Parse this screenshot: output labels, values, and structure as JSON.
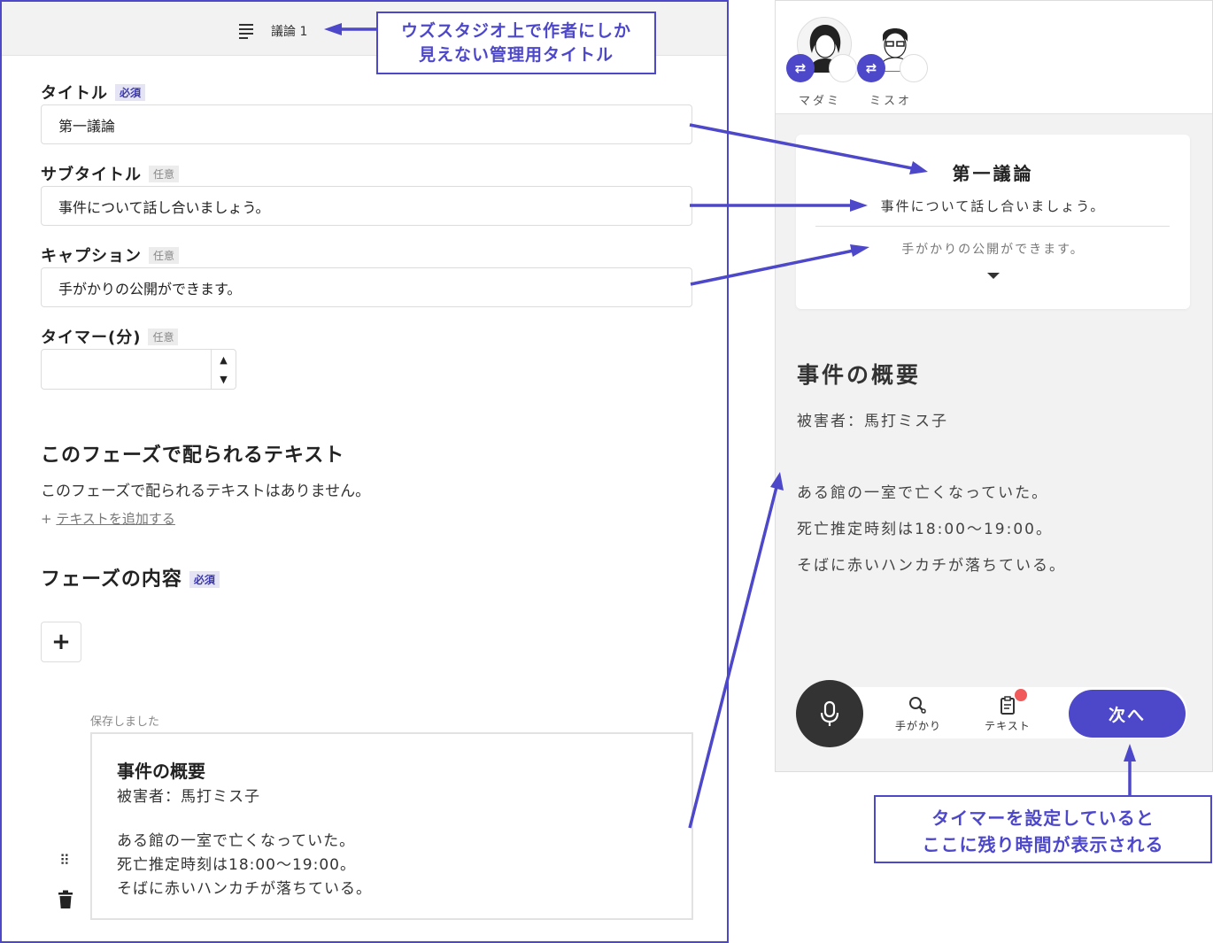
{
  "editor": {
    "header_title": "議論 1",
    "fields": {
      "title": {
        "label": "タイトル",
        "badge": "必須",
        "value": "第一議論"
      },
      "subtitle": {
        "label": "サブタイトル",
        "badge": "任意",
        "value": "事件について話し合いましょう。"
      },
      "caption": {
        "label": "キャプション",
        "badge": "任意",
        "value": "手がかりの公開ができます。"
      },
      "timer": {
        "label": "タイマー(分)",
        "badge": "任意",
        "value": ""
      }
    },
    "texts_section": {
      "title": "このフェーズで配られるテキスト",
      "empty_text": "このフェーズで配られるテキストはありません。",
      "add_prefix": "+",
      "add_link": "テキストを追加する"
    },
    "content_section": {
      "title": "フェーズの内容",
      "badge": "必須",
      "add_symbol": "+",
      "saved_text": "保存しました",
      "block": {
        "heading": "事件の概要",
        "lines": [
          "被害者：馬打ミス子",
          "",
          "ある館の一室で亡くなっていた。",
          "死亡推定時刻は18:00〜19:00。",
          "そばに赤いハンカチが落ちている。"
        ]
      }
    }
  },
  "preview": {
    "players": [
      {
        "name": "マダミ",
        "swap_icon": "⇄"
      },
      {
        "name": "ミスオ",
        "swap_icon": "⇄"
      }
    ],
    "phase_card": {
      "title": "第一議論",
      "subtitle": "事件について話し合いましょう。",
      "caption": "手がかりの公開ができます。"
    },
    "content": {
      "heading": "事件の概要",
      "lines": [
        "被害者：馬打ミス子",
        "ある館の一室で亡くなっていた。",
        "死亡推定時刻は18:00〜19:00。",
        "そばに赤いハンカチが落ちている。"
      ]
    },
    "bottom_bar": {
      "clues_label": "手がかり",
      "texts_label": "テキスト",
      "next_label": "次へ"
    }
  },
  "annotations": {
    "admin_title_note": [
      "ウズスタジオ上で作者にしか",
      "見えない管理用タイトル"
    ],
    "timer_note": [
      "タイマーを設定していると",
      "ここに残り時間が表示される"
    ]
  },
  "colors": {
    "accent": "#4d47c9",
    "notification": "#f05a5a",
    "mic_button": "#333333"
  }
}
